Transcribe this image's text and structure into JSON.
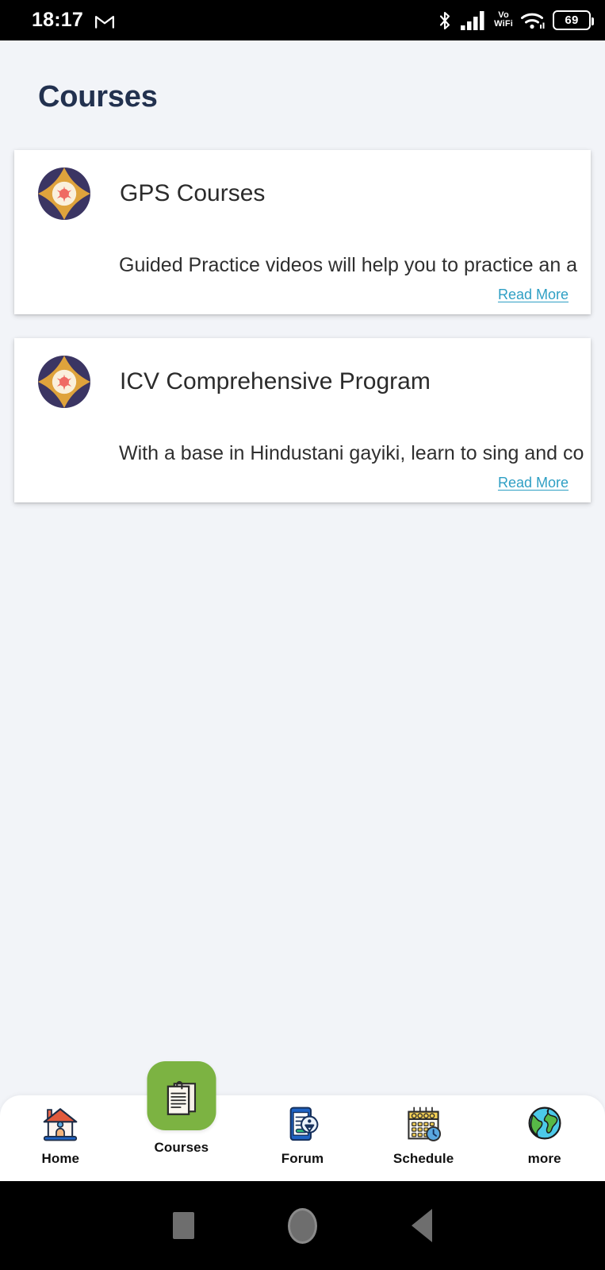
{
  "status_bar": {
    "time": "18:17",
    "gmail_icon": "gmail-icon",
    "bluetooth_icon": "bluetooth-icon",
    "signal_icon": "cellular-signal-icon",
    "vowifi_line1": "Vo",
    "vowifi_line2": "WiFi",
    "wifi_icon": "wifi-icon",
    "battery_level": "69"
  },
  "header": {
    "title": "Courses"
  },
  "cards": [
    {
      "logo": "icv-mandala-logo",
      "title": "GPS Courses",
      "description": "Guided Practice videos will help you to practice an a",
      "read_more": "Read More"
    },
    {
      "logo": "icv-mandala-logo",
      "title": "ICV Comprehensive Program",
      "description": "With a base in Hindustani gayiki, learn to sing and co",
      "read_more": "Read More"
    }
  ],
  "bottom_nav": {
    "active": "Courses",
    "active_color": "#7cb342",
    "items": [
      {
        "label": "Home",
        "icon": "house-icon"
      },
      {
        "label": "Courses",
        "icon": "documents-icon"
      },
      {
        "label": "Forum",
        "icon": "phone-chat-icon"
      },
      {
        "label": "Schedule",
        "icon": "calendar-clock-icon"
      },
      {
        "label": "more",
        "icon": "globe-icon"
      }
    ]
  },
  "android_nav": {
    "recents": "square-recents-icon",
    "home": "circle-home-icon",
    "back": "triangle-back-icon"
  },
  "colors": {
    "page_background": "#f2f4f8",
    "card_background": "#ffffff",
    "title_navy": "#22314f",
    "link_teal": "#2e9fc4",
    "accent_green": "#7cb342"
  }
}
